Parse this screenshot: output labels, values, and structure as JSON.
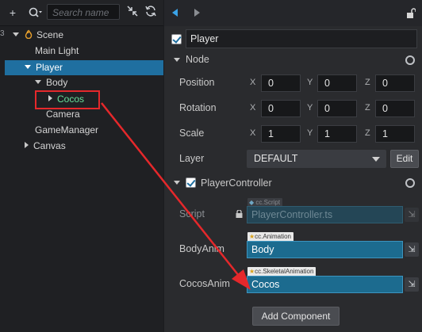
{
  "hierarchy": {
    "toolbar": {
      "add_icon": "+",
      "search_icon": "search-icon",
      "search_placeholder": "Search name"
    },
    "nodes": [
      {
        "label": "Scene"
      },
      {
        "label": "Main Light"
      },
      {
        "label": "Player"
      },
      {
        "label": "Body"
      },
      {
        "label": "Cocos"
      },
      {
        "label": "Camera"
      },
      {
        "label": "GameManager"
      },
      {
        "label": "Canvas"
      }
    ],
    "edge_marker": "3"
  },
  "inspector": {
    "node_name": "Player",
    "node_section": "Node",
    "position": {
      "label": "Position",
      "x": "0",
      "y": "0",
      "z": "0"
    },
    "rotation": {
      "label": "Rotation",
      "x": "0",
      "y": "0",
      "z": "0"
    },
    "scale": {
      "label": "Scale",
      "x": "1",
      "y": "1",
      "z": "1"
    },
    "axis": {
      "x": "X",
      "y": "Y",
      "z": "Z"
    },
    "layer": {
      "label": "Layer",
      "value": "DEFAULT",
      "edit_button": "Edit"
    },
    "component": {
      "title": "PlayerController",
      "script_label": "Script",
      "script_tag": "cc.Script",
      "script_value": "PlayerController.ts",
      "bodyanim_label": "BodyAnim",
      "bodyanim_tag": "cc.Animation",
      "bodyanim_value": "Body",
      "cocosanim_label": "CocosAnim",
      "cocosanim_tag": "cc.SkeletalAnimation",
      "cocosanim_value": "Cocos"
    },
    "add_component_button": "Add Component"
  },
  "colors": {
    "selection": "#1f6fa0",
    "highlight_box": "#e5282b",
    "arrow": "#e5282b",
    "field_blue": "#1c6b8f"
  }
}
